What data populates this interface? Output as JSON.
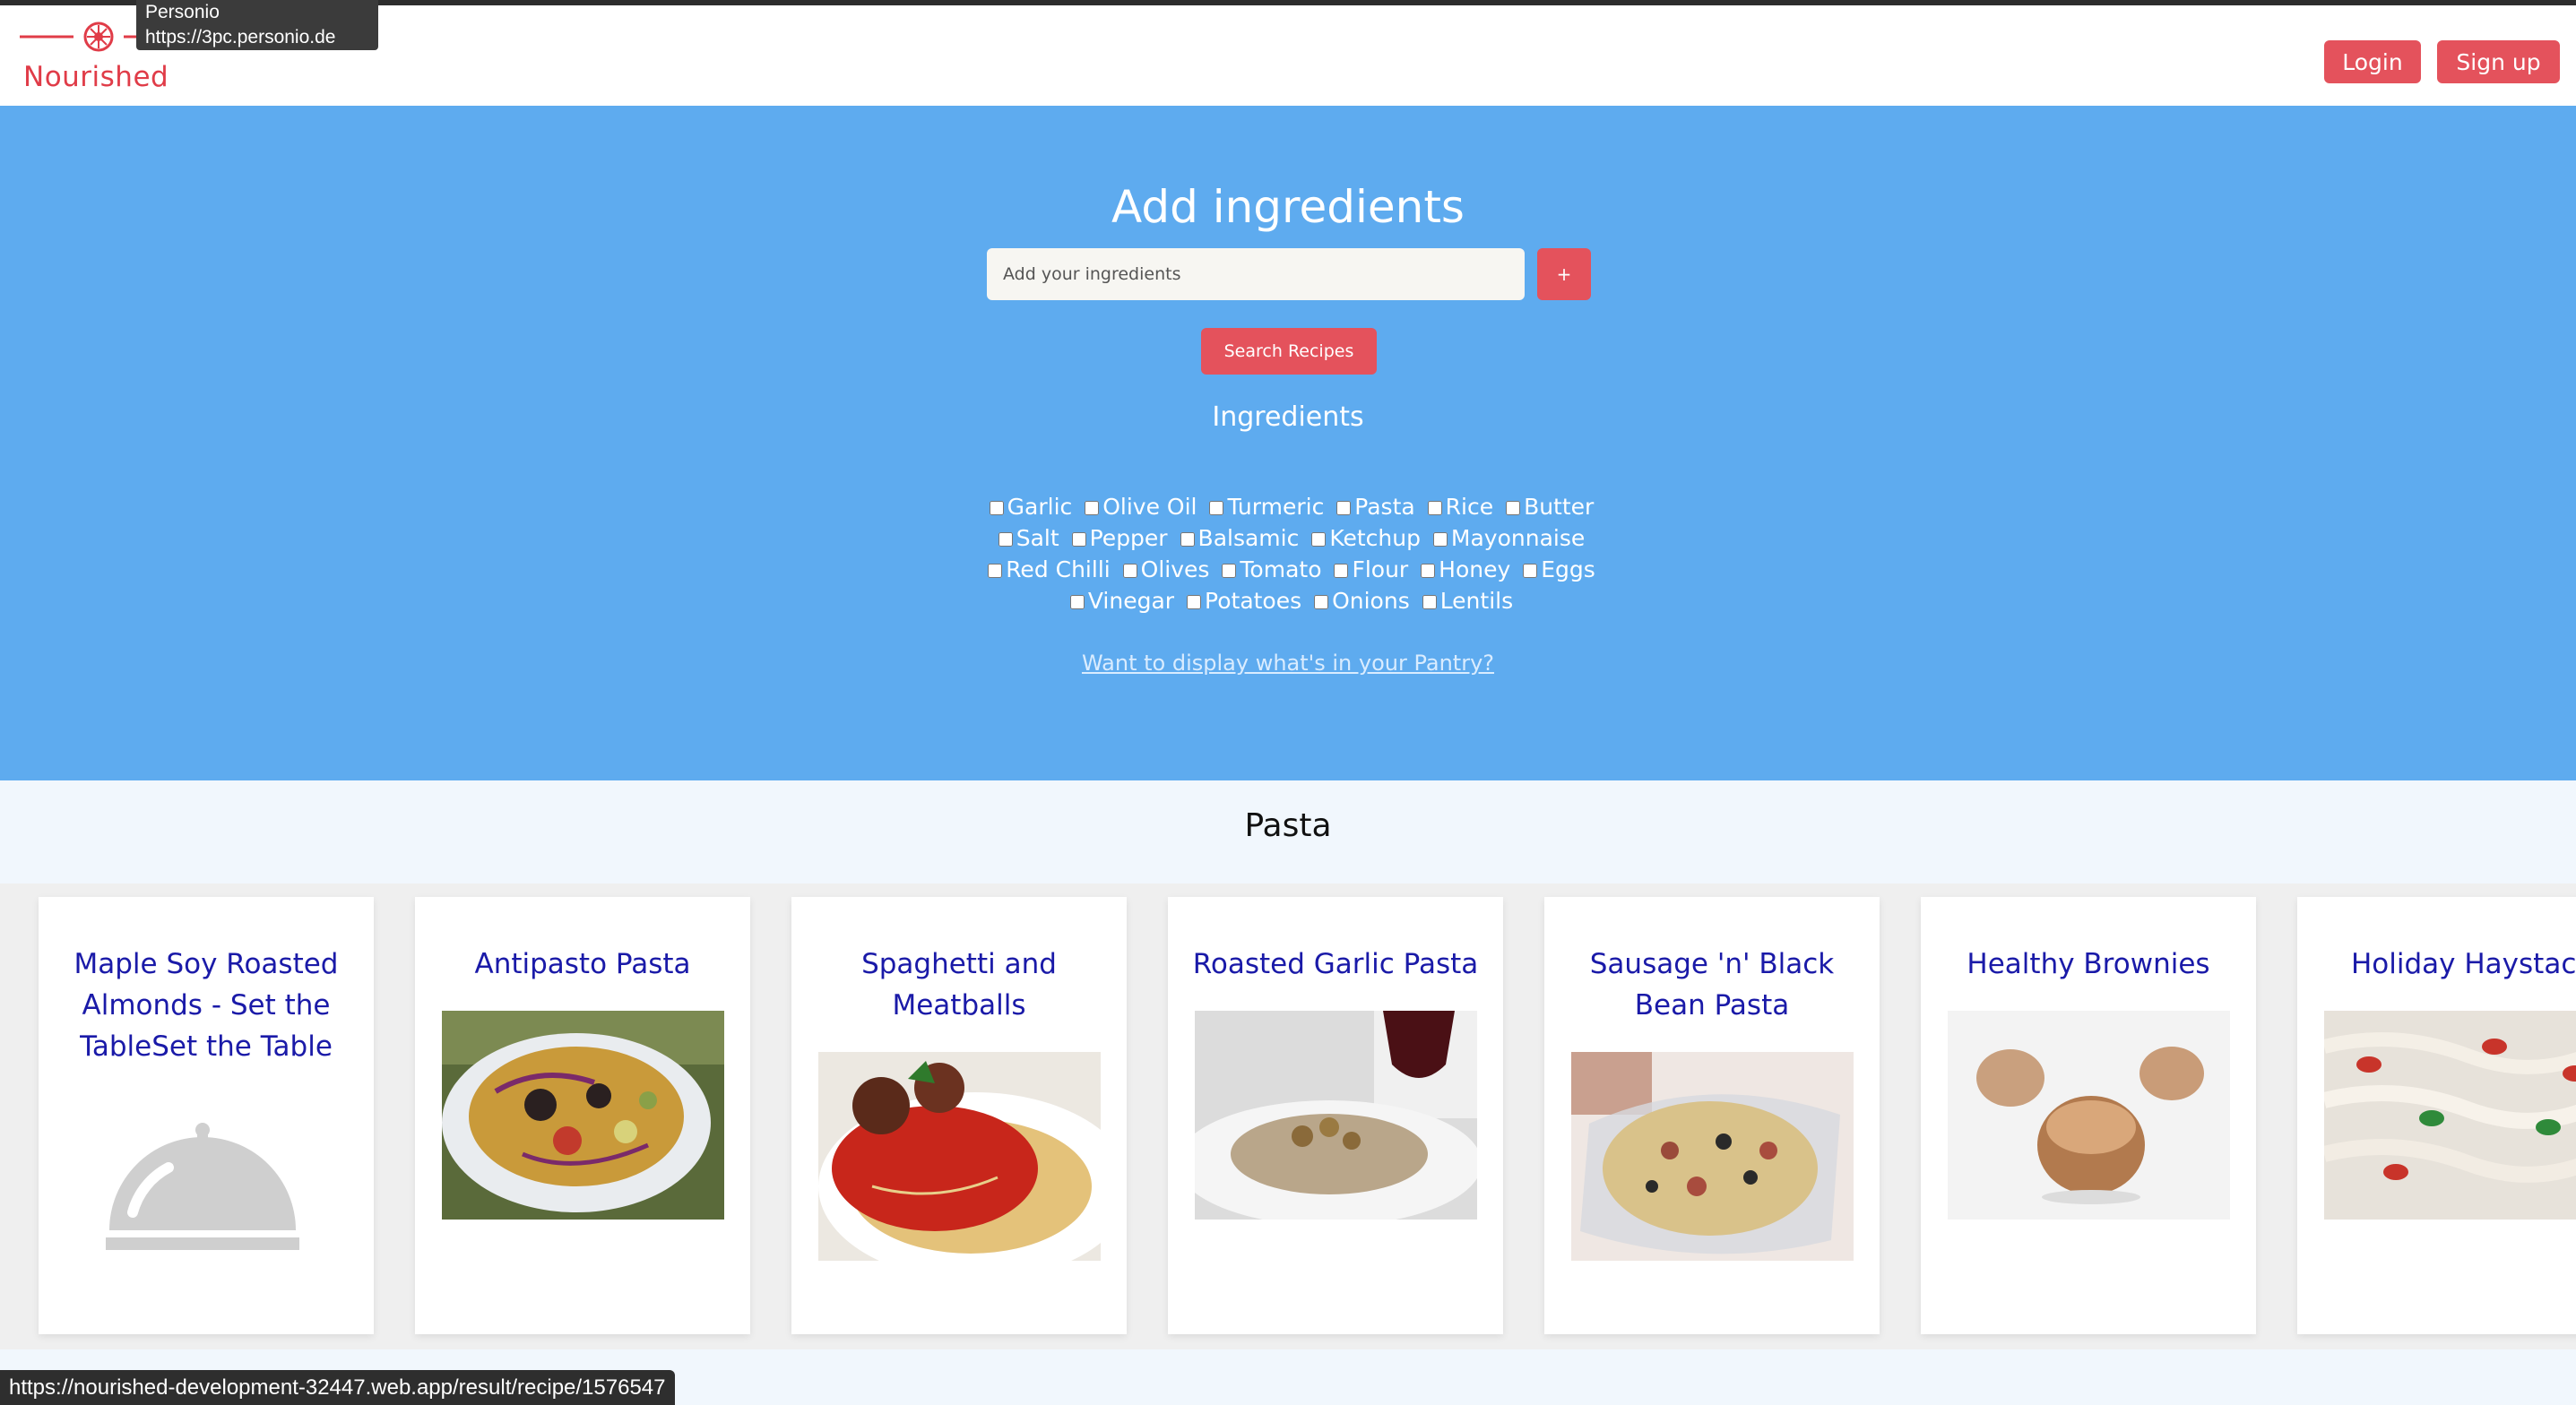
{
  "tooltip": {
    "line1": "Personio",
    "line2": "https://3pc.personio.de"
  },
  "brand": {
    "name": "Nourished",
    "accent": "#e4525c",
    "hero_color": "#5eabef"
  },
  "nav": {
    "login": "Login",
    "signup": "Sign up"
  },
  "hero": {
    "title": "Add ingredients",
    "input_placeholder": "Add your ingredients",
    "add_button": "+",
    "search_button": "Search Recipes",
    "ingredients_heading": "Ingredients",
    "ingredients": [
      "Garlic",
      "Olive Oil",
      "Turmeric",
      "Pasta",
      "Rice",
      "Butter",
      "Salt",
      "Pepper",
      "Balsamic",
      "Ketchup",
      "Mayonnaise",
      "Red Chilli",
      "Olives",
      "Tomato",
      "Flour",
      "Honey",
      "Eggs",
      "Vinegar",
      "Potatoes",
      "Onions",
      "Lentils"
    ],
    "pantry_link": "Want to display what's in your Pantry?"
  },
  "section": {
    "title": "Pasta"
  },
  "recipes": [
    {
      "title": "Maple Soy Roasted Almonds - Set the TableSet the Table",
      "image": "placeholder-cloche-icon"
    },
    {
      "title": "Antipasto Pasta",
      "image": "pasta-salad-photo"
    },
    {
      "title": "Spaghetti and Meatballs",
      "image": "spaghetti-meatballs-photo"
    },
    {
      "title": "Roasted Garlic Pasta",
      "image": "garlic-pasta-photo"
    },
    {
      "title": "Sausage 'n' Black Bean Pasta",
      "image": "sausage-pasta-photo"
    },
    {
      "title": "Healthy Brownies",
      "image": "brownie-bites-photo"
    },
    {
      "title": "Holiday Haystacks",
      "image": "haystacks-photo"
    }
  ],
  "status_url": "https://nourished-development-32447.web.app/result/recipe/1576547"
}
